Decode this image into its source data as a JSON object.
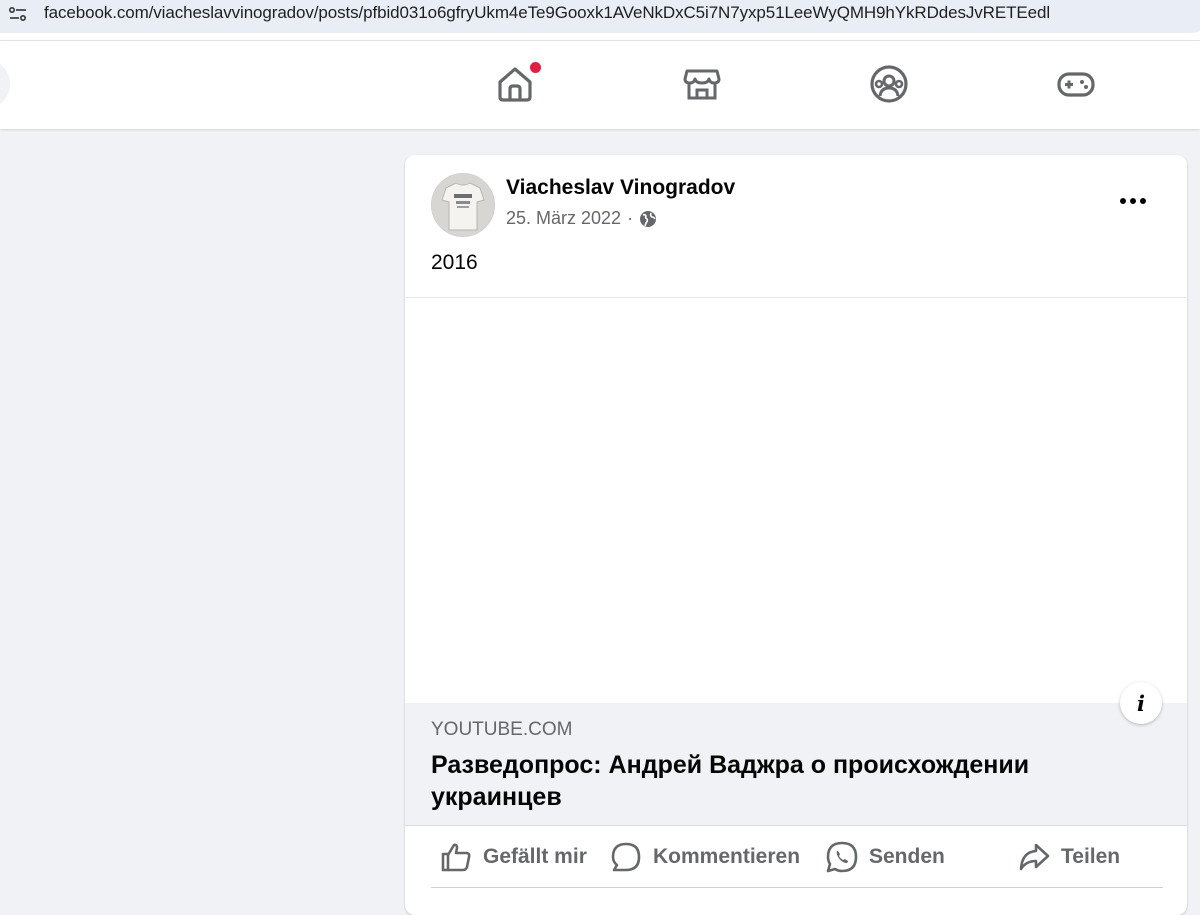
{
  "browser": {
    "url": "facebook.com/viacheslavvinogradov/posts/pfbid031o6gfryUkm4eTe9Gooxk1AVeNkDxC5i7N7yxp51LeeWyQMH9hYkRDdesJvRETEedl"
  },
  "nav": {
    "items": [
      {
        "icon": "home-icon"
      },
      {
        "icon": "marketplace-icon"
      },
      {
        "icon": "groups-icon"
      },
      {
        "icon": "gaming-icon"
      }
    ],
    "notification_color": "#e41e3f"
  },
  "post": {
    "author": "Viacheslav Vinogradov",
    "date": "25. März 2022",
    "separator": "·",
    "privacy_icon": "globe-icon",
    "text": "2016",
    "link": {
      "domain": "YOUTUBE.COM",
      "title": "Разведопрос: Андрей Ваджра о происхождении украинцев"
    },
    "info_label": "i",
    "actions": {
      "like": "Gefällt mir",
      "comment": "Kommentieren",
      "send": "Senden",
      "share": "Teilen"
    }
  }
}
